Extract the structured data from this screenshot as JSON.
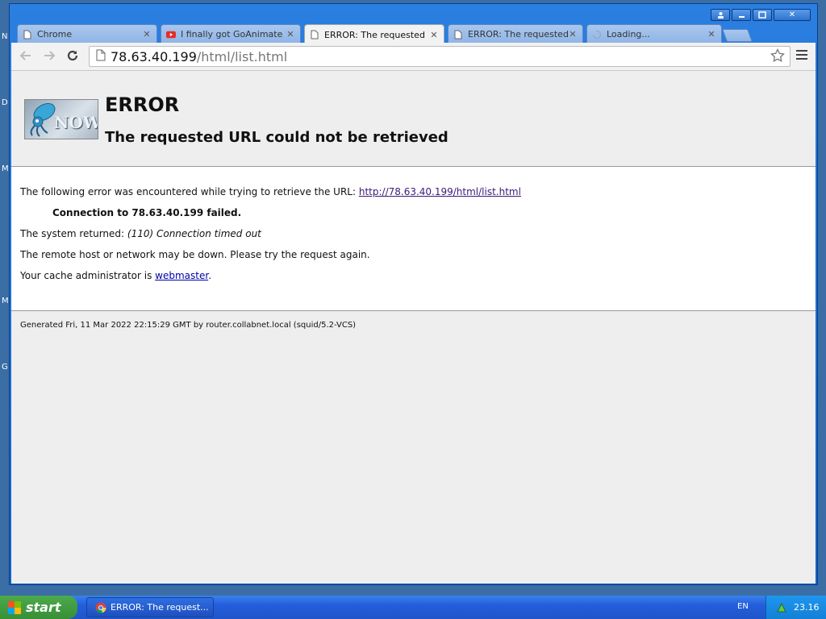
{
  "desktop": {
    "side_letters": [
      "N",
      "D",
      "M",
      "M",
      "G"
    ]
  },
  "window": {
    "tabs": [
      {
        "title": "Chrome",
        "icon": "page-icon",
        "active": false
      },
      {
        "title": "I finally got GoAnimate F",
        "icon": "youtube-icon",
        "active": false
      },
      {
        "title": "ERROR: The requested",
        "icon": "page-icon",
        "active": true
      },
      {
        "title": "ERROR: The requested",
        "icon": "page-icon",
        "active": false
      },
      {
        "title": "Loading...",
        "icon": "loading-icon",
        "active": false
      }
    ],
    "close_glyph": "✕"
  },
  "toolbar": {
    "url_host": "78.63.40.199",
    "url_path": "/html/list.html"
  },
  "page": {
    "logo_text": "NOW",
    "heading": "ERROR",
    "subheading": "The requested URL could not be retrieved",
    "line1_text": "The following error was encountered while trying to retrieve the URL: ",
    "line1_link": "http://78.63.40.199/html/list.html",
    "line2": "Connection to 78.63.40.199 failed.",
    "line3_text": "The system returned: ",
    "line3_em": "(110) Connection timed out",
    "line4": "The remote host or network may be down. Please try the request again.",
    "line5_text": "Your cache administrator is ",
    "line5_link": "webmaster",
    "line5_end": ".",
    "footer": "Generated Fri, 11 Mar 2022 22:15:29 GMT by router.collabnet.local (squid/5.2-VCS)"
  },
  "taskbar": {
    "start_label": "start",
    "task_label": "ERROR: The request...",
    "language": "EN",
    "clock": "23.16"
  },
  "colors": {
    "link_visited": "#3b1a7a",
    "link": "#0000aa",
    "taskbar_blue": "#245edb",
    "start_green": "#378f37"
  }
}
